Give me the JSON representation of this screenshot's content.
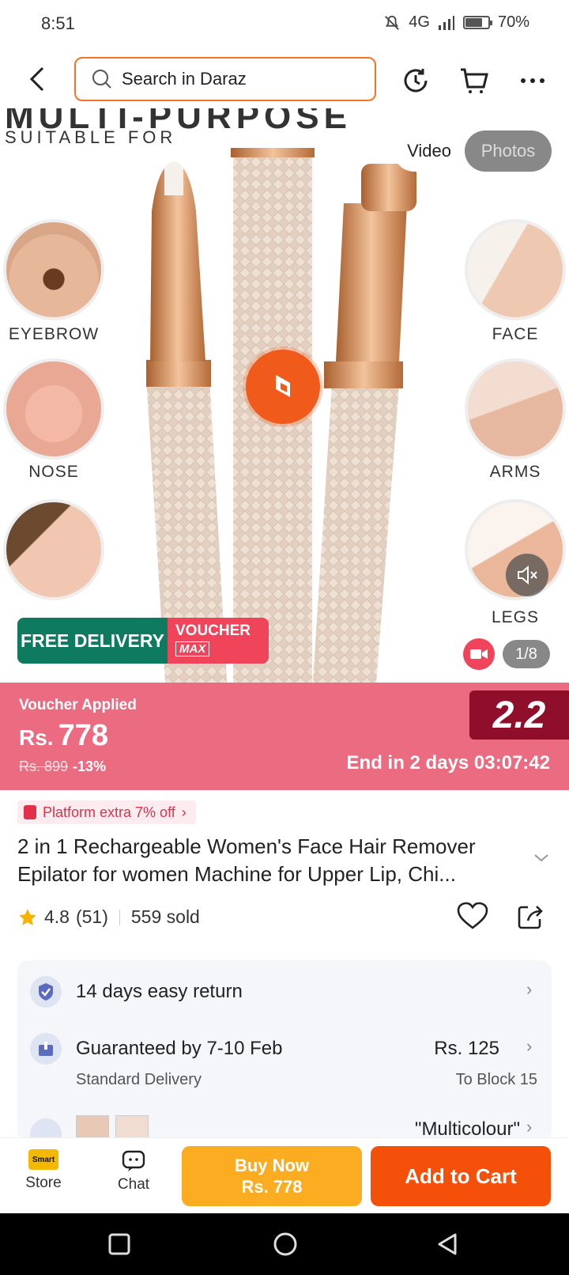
{
  "status": {
    "time": "8:51",
    "network": "4G",
    "battery": "70%"
  },
  "header": {
    "search_placeholder": "Search in Daraz"
  },
  "media": {
    "banner_top": "MULTI-PURPOSE",
    "banner_sub": "SUITABLE FOR",
    "toggle": {
      "video": "Video",
      "photos": "Photos"
    },
    "areas": [
      "EYEBROW",
      "FACE",
      "NOSE",
      "ARMS",
      "LEGS"
    ],
    "free_delivery": "FREE DELIVERY",
    "voucher": {
      "line1": "VOUCHER",
      "line2": "MAX"
    },
    "counter": "1/8"
  },
  "price": {
    "voucher_applied": "Voucher Applied",
    "currency": "Rs.",
    "amount": "778",
    "original": "Rs. 899",
    "discount": "-13%",
    "campaign": "2.2",
    "countdown": "End in 2 days 03:07:42"
  },
  "product": {
    "promo": "Platform extra 7% off",
    "title_line1": "2 in 1 Rechargeable Women's Face Hair Remover",
    "title_line2": "Epilator for women Machine for Upper Lip, Chi...",
    "rating": "4.8",
    "reviews": "(51)",
    "sold": "559 sold"
  },
  "services": {
    "return": "14 days easy return",
    "guarantee": "Guaranteed by 7-10 Feb",
    "delivery_type": "Standard Delivery",
    "delivery_fee": "Rs. 125",
    "delivery_to": "To Block 15",
    "variant": "\"Multicolour\""
  },
  "bottom": {
    "store": "Store",
    "store_logo": "Smart",
    "chat": "Chat",
    "buy_now": "Buy Now",
    "buy_now_price": "Rs. 778",
    "add_to_cart": "Add to Cart"
  },
  "colors": {
    "accent": "#f57224",
    "price_bg": "#eb6b81",
    "buy_now": "#fcac20",
    "add_to_cart": "#f5500a"
  }
}
